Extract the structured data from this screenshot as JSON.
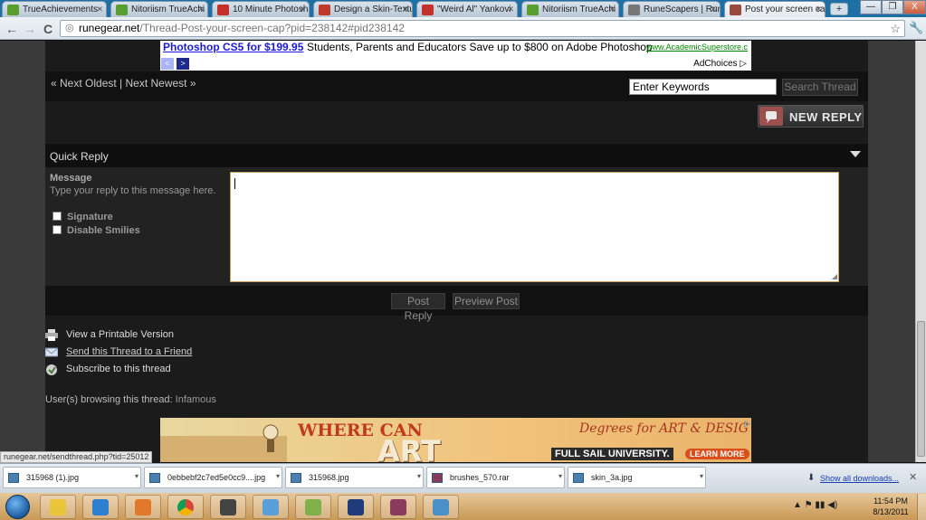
{
  "browser": {
    "tabs": [
      {
        "title": "TrueAchievements",
        "icon_color": "#5a9e2f",
        "active": false
      },
      {
        "title": "Nitoriism TrueAchi",
        "icon_color": "#5a9e2f",
        "active": false
      },
      {
        "title": "10 Minute Photosh",
        "icon_color": "#c4302b",
        "active": false
      },
      {
        "title": "Design a Skin-Textu",
        "icon_color": "#c03a2b",
        "active": false
      },
      {
        "title": "\"Weird Al\" Yankovi",
        "icon_color": "#c4302b",
        "active": false
      },
      {
        "title": "Nitoriism TrueAchi",
        "icon_color": "#5a9e2f",
        "active": false
      },
      {
        "title": "RuneScapers | Rune",
        "icon_color": "#777777",
        "active": false
      },
      {
        "title": "Post your screen ca",
        "icon_color": "#9a4a3a",
        "active": true
      }
    ],
    "new_tab": "+",
    "window_buttons": [
      "—",
      "❐",
      "X"
    ],
    "back": "←",
    "forward": "→",
    "reload": "C",
    "url_domain": "runegear.net",
    "url_path": "/Thread-Post-your-screen-cap?pid=238142#pid238142",
    "star": "☆",
    "wrench": "🔧"
  },
  "top_ad": {
    "title": "Photoshop CS5 for $199.95",
    "text": "Students, Parents and Educators Save up to $800 on Adobe Photoshop",
    "url": "www.AcademicSuperstore.c",
    "prev": "<",
    "next": ">",
    "adchoices": "AdChoices ▷"
  },
  "thread_nav": {
    "next_links": "« Next Oldest | Next Newest »",
    "keywords_value": "Enter Keywords",
    "search_button": "Search Thread"
  },
  "new_reply": {
    "label": "NEW REPLY"
  },
  "quick_reply": {
    "title": "Quick Reply",
    "message_label": "Message",
    "message_hint": "Type your reply to this message here.",
    "signature_label": "Signature",
    "smilies_label": "Disable Smilies",
    "post_button": "Post Reply",
    "preview_button": "Preview Post"
  },
  "tools": [
    {
      "label": "View a Printable Version",
      "icon": "printer-icon",
      "link": false
    },
    {
      "label": "Send this Thread to a Friend",
      "icon": "envelope-icon",
      "link": true
    },
    {
      "label": "Subscribe to this thread",
      "icon": "subscribe-icon",
      "link": false
    }
  ],
  "browsing": {
    "label": "User(s) browsing this thread:",
    "users": "Infamous"
  },
  "bottom_ad": {
    "where_can": "WHERE CAN",
    "art": "ART",
    "degrees": "Degrees for ART & DESIG",
    "school": "FULL SAIL UNIVERSITY.",
    "learn_more": "LEARN MORE"
  },
  "status_url": "runegear.net/sendthread.php?tid=25012",
  "downloads": {
    "items": [
      "315968 (1).jpg",
      "0ebbebf2c7ed5e0cc9....jpg",
      "315968.jpg",
      "brushes_570.rar",
      "skin_3a.jpg"
    ],
    "show_all": "Show all downloads...",
    "close": "✕"
  },
  "taskbar": {
    "apps": [
      {
        "name": "explorer-icon",
        "color": "#e9c53a"
      },
      {
        "name": "ie-icon",
        "color": "#2f7fd0"
      },
      {
        "name": "media-player-icon",
        "color": "#e07a2a"
      },
      {
        "name": "chrome-icon",
        "color": "#3aa757"
      },
      {
        "name": "camera-icon",
        "color": "#444444"
      },
      {
        "name": "messenger-icon",
        "color": "#5aa0d8"
      },
      {
        "name": "paint-icon",
        "color": "#7fb04a"
      },
      {
        "name": "photoshop-icon",
        "color": "#1f3c7a"
      },
      {
        "name": "winrar-icon",
        "color": "#8a3a5a"
      },
      {
        "name": "image-viewer-icon",
        "color": "#4a90c8"
      }
    ],
    "tray": "▲  ⚑  ▮▮  ◀)",
    "time": "11:54 PM",
    "date": "8/13/2011"
  }
}
